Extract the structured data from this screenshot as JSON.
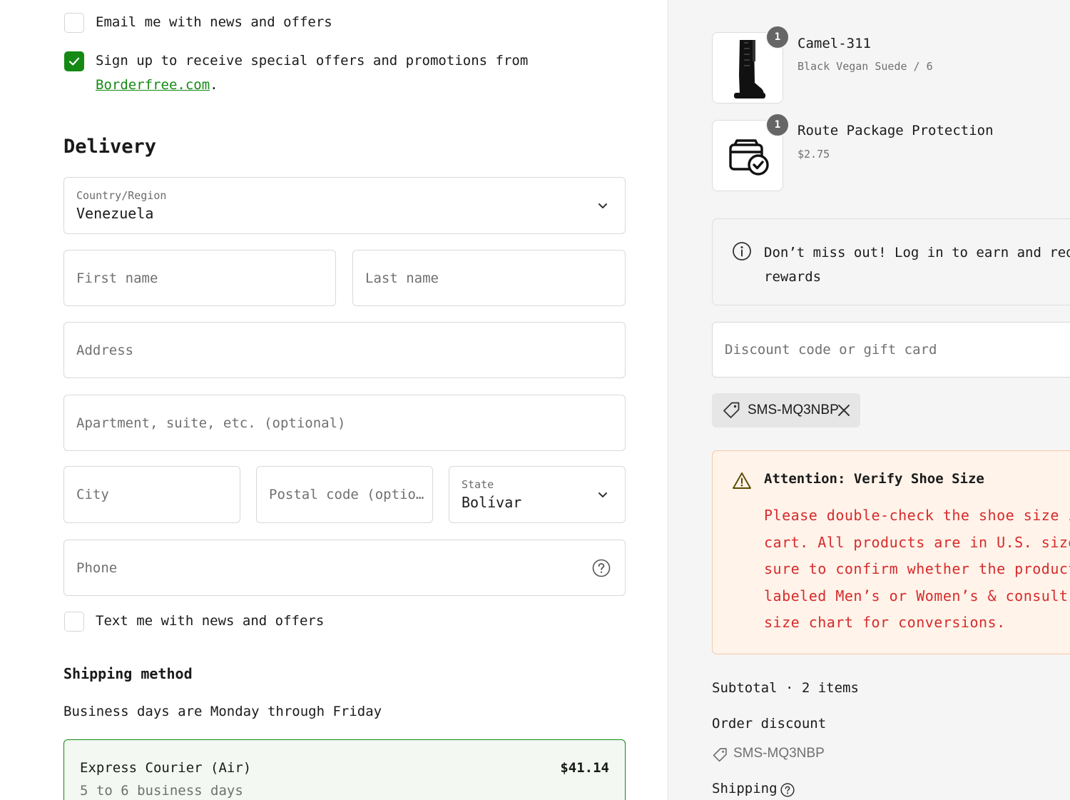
{
  "marketing": {
    "email_label": "Email me with news and offers",
    "borderfree_label": "Sign up to receive special offers and promotions from",
    "borderfree_link": "Borderfree.com",
    "borderfree_period": ".",
    "borderfree_checked": true
  },
  "delivery": {
    "heading": "Delivery",
    "country_label": "Country/Region",
    "country_value": "Venezuela",
    "first_name_placeholder": "First name",
    "last_name_placeholder": "Last name",
    "address_placeholder": "Address",
    "apartment_placeholder": "Apartment, suite, etc. (optional)",
    "city_placeholder": "City",
    "postal_placeholder": "Postal code (optio…",
    "state_label": "State",
    "state_value": "Bolívar",
    "phone_placeholder": "Phone",
    "sms_label": "Text me with news and offers"
  },
  "shipping": {
    "heading": "Shipping method",
    "note": "Business days are Monday through Friday",
    "option_name": "Express Courier (Air)",
    "option_price": "$41.14",
    "option_days": "5 to 6 business days"
  },
  "cart": {
    "items": [
      {
        "quantity": "1",
        "name": "Camel-311",
        "variant": "Black Vegan Suede / 6"
      },
      {
        "quantity": "1",
        "name": "Route Package Protection",
        "variant": "$2.75"
      }
    ]
  },
  "rewards": {
    "line1": "Don’t miss out! Log in to earn and redee",
    "line2": "rewards"
  },
  "discount": {
    "placeholder": "Discount code or gift card",
    "applied_code": "SMS-MQ3NBP"
  },
  "attention": {
    "title": "Attention: Verify Shoe Size",
    "lines": [
      "Please double-check the shoe size i",
      "cart. All products are in U.S. size",
      "sure to confirm whether the product",
      "labeled Men’s or Women’s & consult",
      "size chart for conversions."
    ]
  },
  "summary": {
    "subtotal_label": "Subtotal · 2 items",
    "order_discount_label": "Order discount",
    "discount_code": "SMS-MQ3NBP",
    "shipping_label": "Shipping"
  },
  "colors": {
    "accent": "#148a14",
    "warning_text": "#d62b2b",
    "warning_bg": "#fff3ea"
  }
}
